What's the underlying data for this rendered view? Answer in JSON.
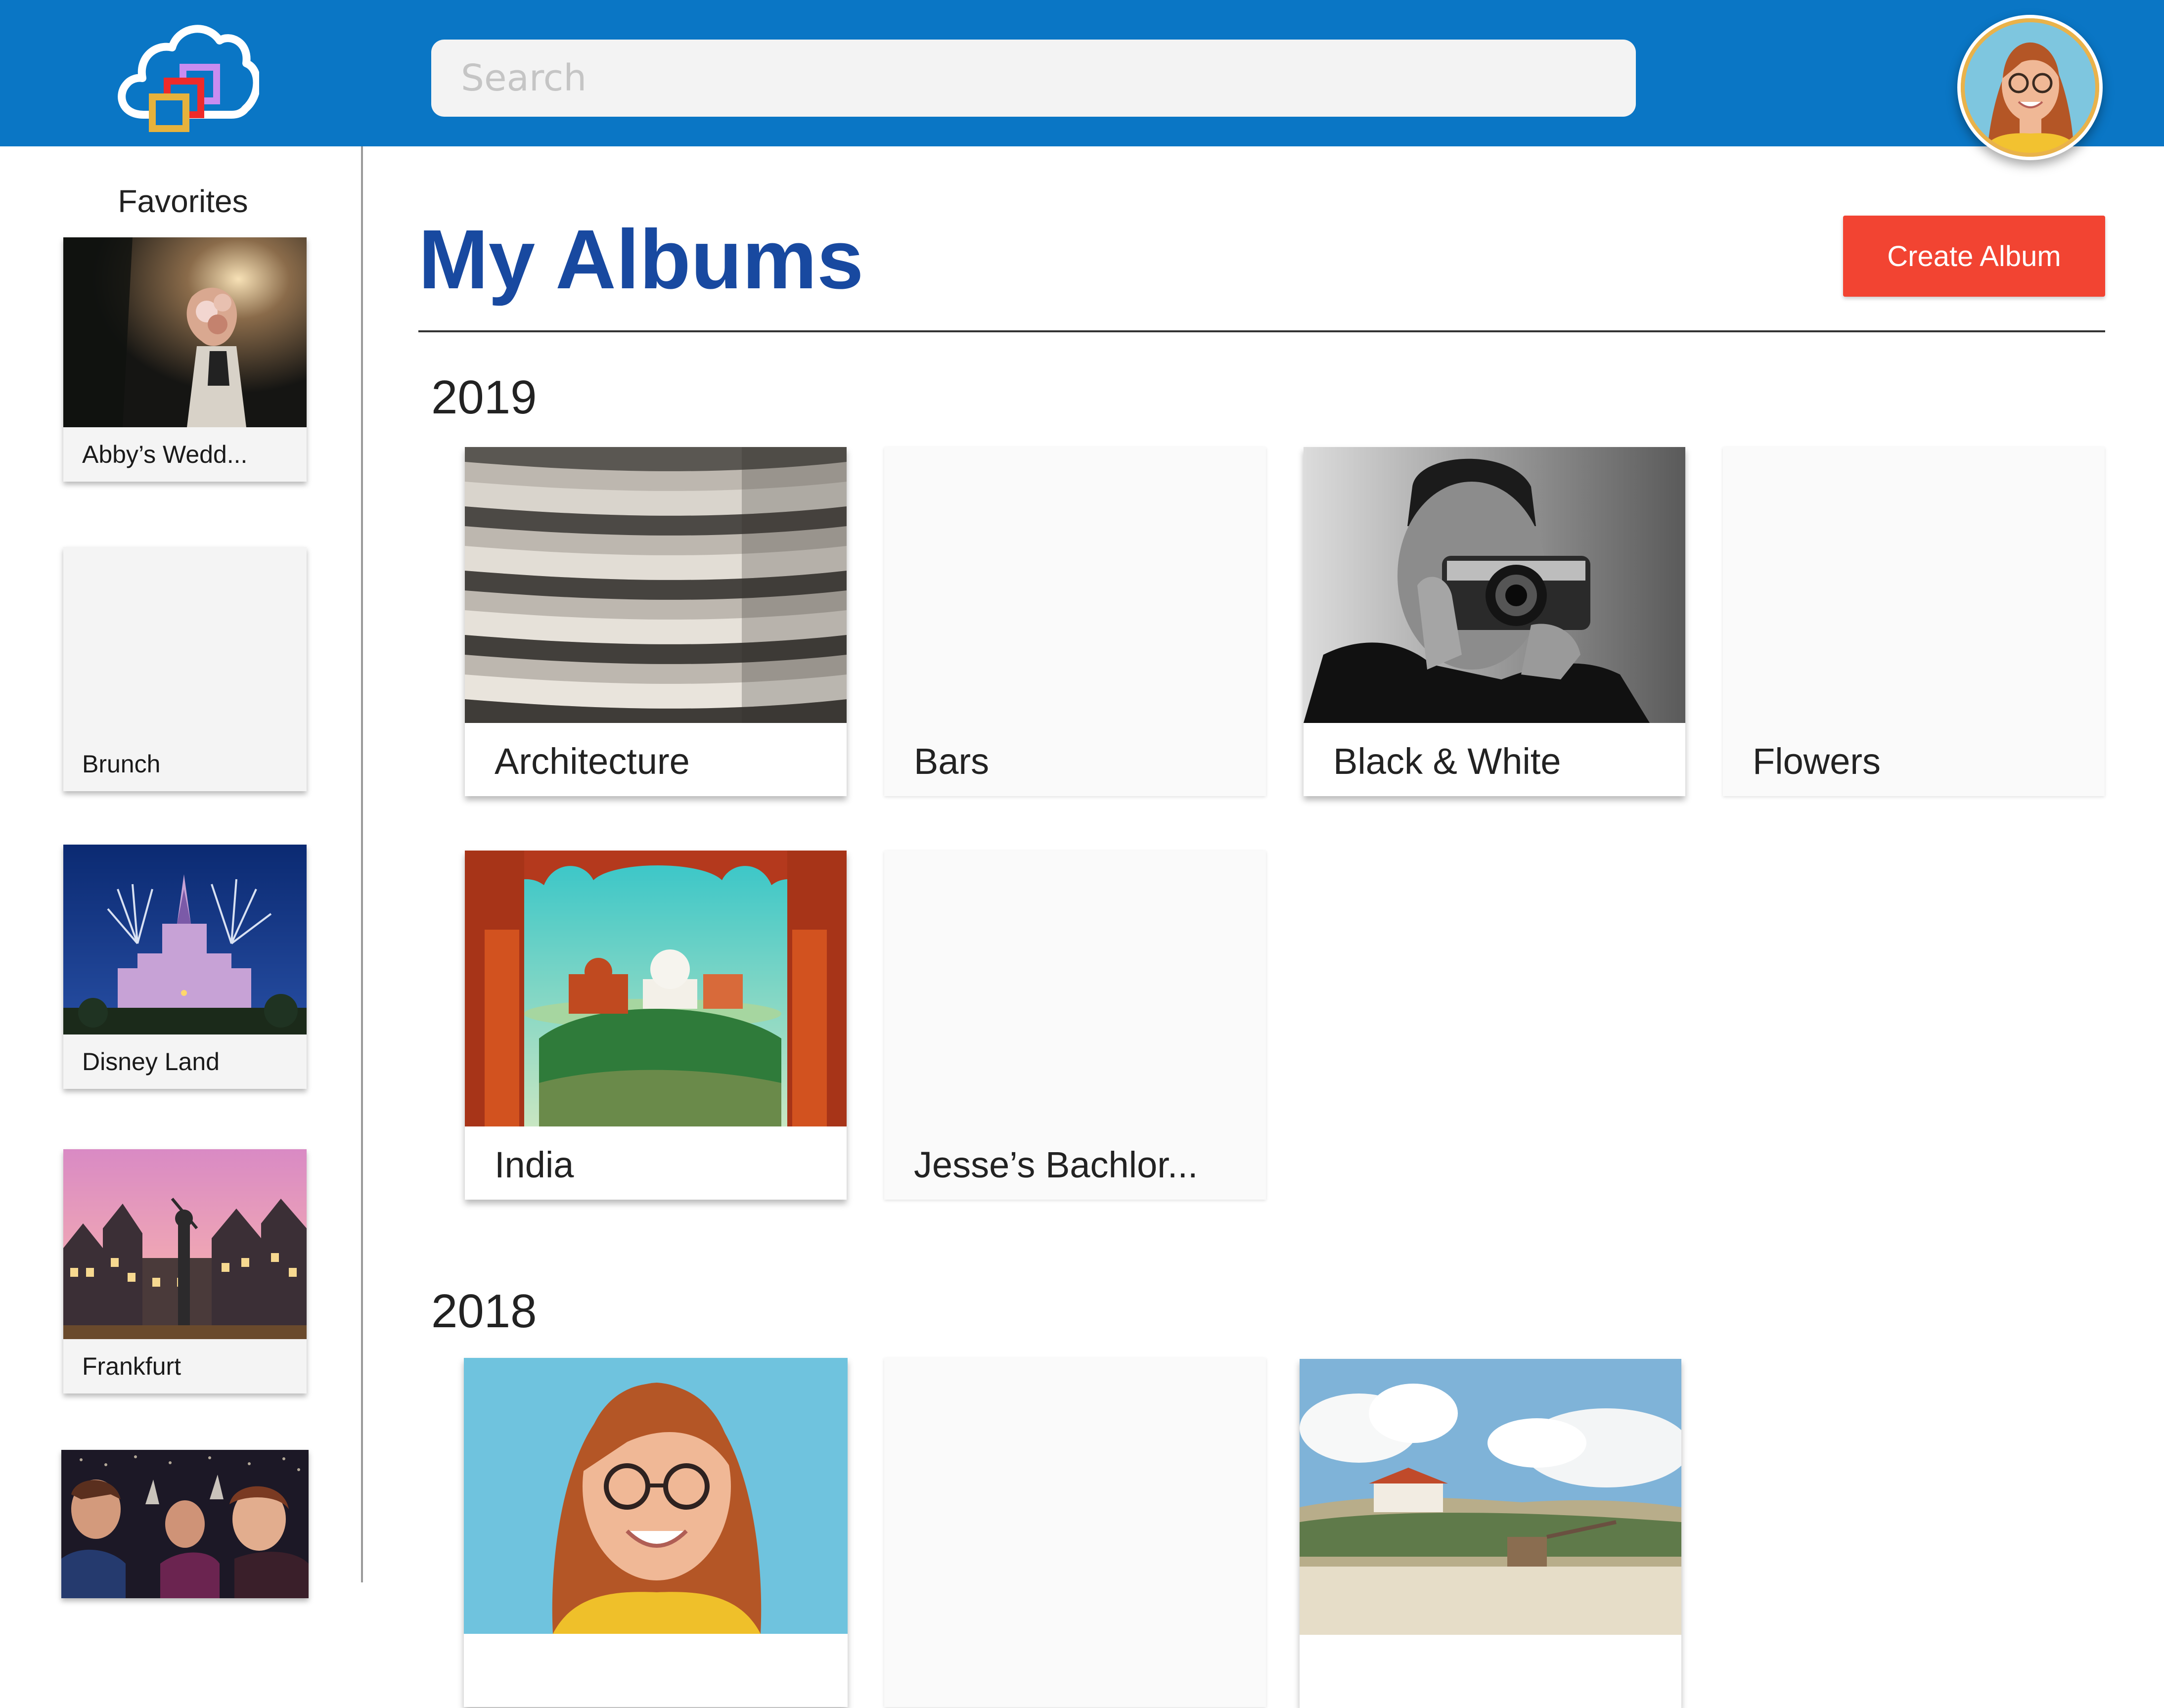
{
  "header": {
    "search": {
      "placeholder": "Search",
      "value": ""
    },
    "logo_icon": "cloud-photos-logo",
    "profile_icon": "user-avatar"
  },
  "sidebar": {
    "title": "Favorites",
    "items": [
      {
        "label": "Abby’s Wedd...",
        "has_thumbnail": true
      },
      {
        "label": "Brunch",
        "has_thumbnail": false
      },
      {
        "label": "Disney Land",
        "has_thumbnail": true
      },
      {
        "label": "Frankfurt",
        "has_thumbnail": true
      },
      {
        "label": "",
        "has_thumbnail": true
      }
    ]
  },
  "main": {
    "title": "My Albums",
    "create_button": "Create Album",
    "groups": [
      {
        "year": "2019",
        "albums": [
          {
            "label": "Architecture",
            "has_cover": true
          },
          {
            "label": "Bars",
            "has_cover": false
          },
          {
            "label": "Black & White",
            "has_cover": true
          },
          {
            "label": "Flowers",
            "has_cover": false
          },
          {
            "label": "India",
            "has_cover": true
          },
          {
            "label": "Jesse’s Bachlor...",
            "has_cover": false
          }
        ]
      },
      {
        "year": "2018",
        "albums": [
          {
            "label": "",
            "has_cover": true
          },
          {
            "label": "",
            "has_cover": false
          },
          {
            "label": "",
            "has_cover": true
          }
        ]
      }
    ]
  },
  "colors": {
    "header_blue": "#0a76c5",
    "title_blue": "#1849a0",
    "create_button_red": "#f24432"
  }
}
